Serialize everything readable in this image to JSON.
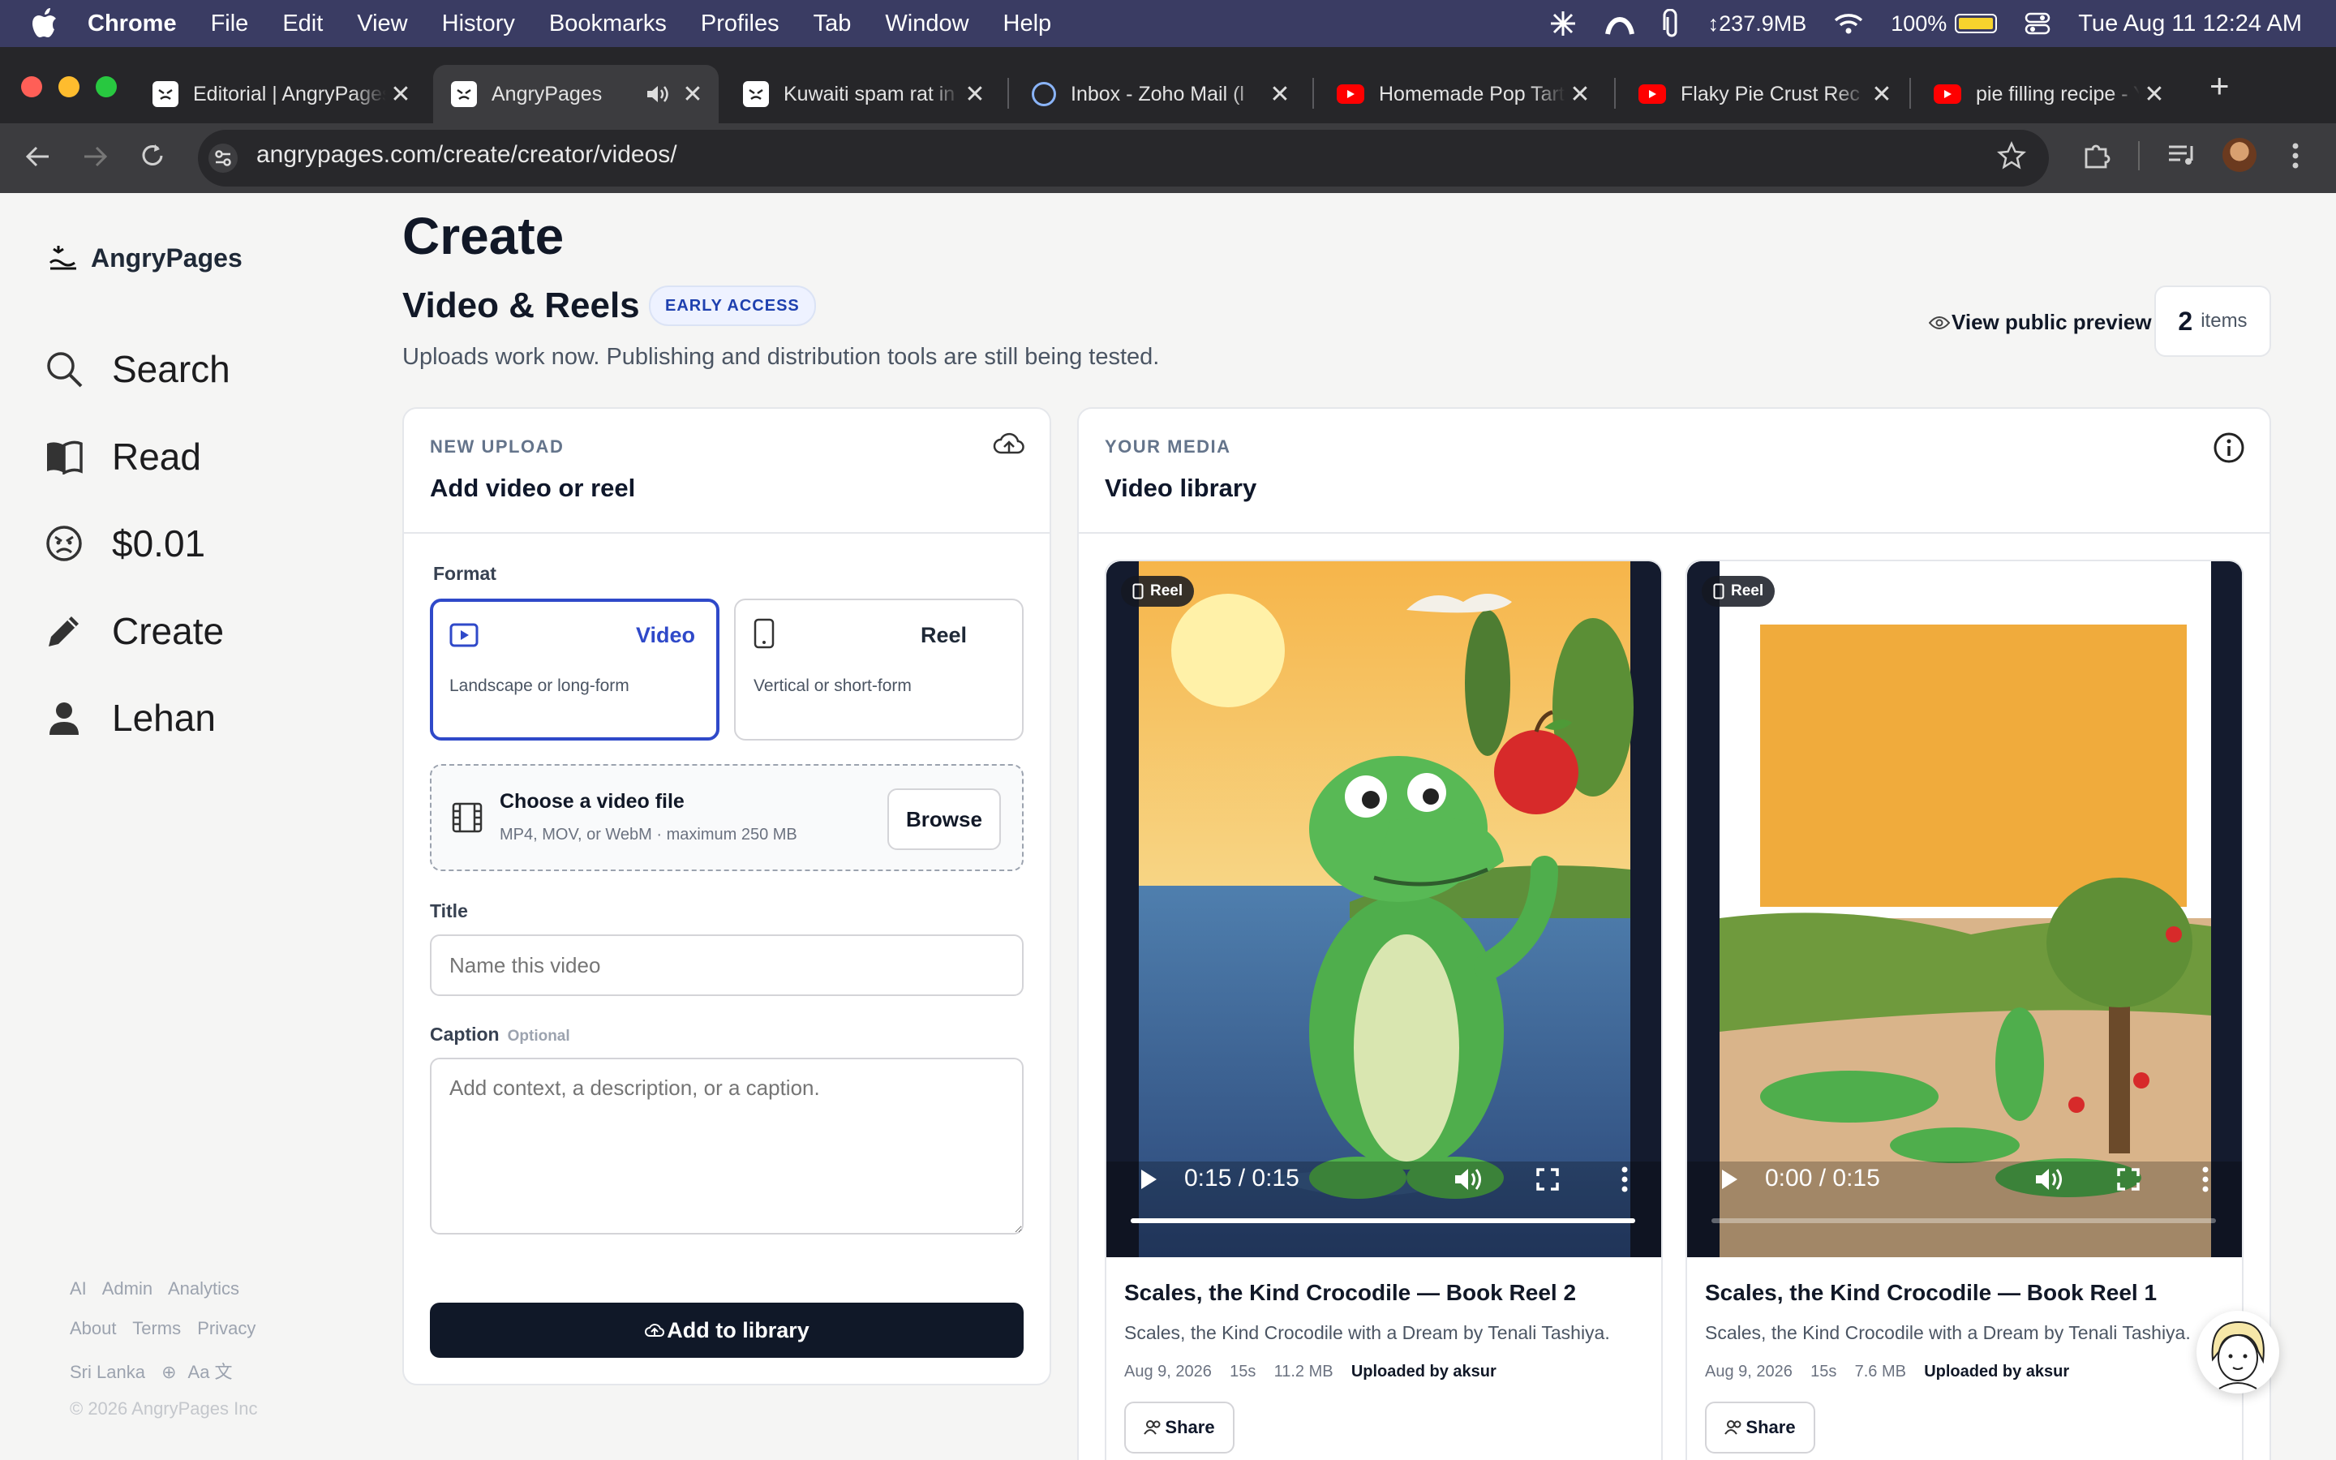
{
  "menubar": {
    "app": "Chrome",
    "items": [
      "File",
      "Edit",
      "View",
      "History",
      "Bookmarks",
      "Profiles",
      "Tab",
      "Window",
      "Help"
    ],
    "memory": "↕237.9MB",
    "battery": "100%",
    "clock": "Tue Aug 11  12:24 AM"
  },
  "tabs": [
    {
      "title": "Editorial | AngryPages",
      "favicon": "angrypages-icon"
    },
    {
      "title": "AngryPages",
      "favicon": "angrypages-icon",
      "active": true
    },
    {
      "title": "Kuwaiti spam rat in",
      "favicon": "angrypages-icon"
    },
    {
      "title": "Inbox - Zoho Mail (l",
      "favicon": "zoho-mail-icon"
    },
    {
      "title": "Homemade Pop Tart",
      "favicon": "youtube-icon"
    },
    {
      "title": "Flaky Pie Crust Rec",
      "favicon": "youtube-icon"
    },
    {
      "title": "pie filling recipe - Y",
      "favicon": "youtube-icon"
    }
  ],
  "address": {
    "url": "angrypages.com/create/creator/videos/"
  },
  "sidebar": {
    "brand": "AngryPages",
    "items": [
      {
        "label": "Search",
        "icon": "search-icon"
      },
      {
        "label": "Read",
        "icon": "book-icon"
      },
      {
        "label": "$0.01",
        "icon": "angry-face-icon"
      },
      {
        "label": "Create",
        "icon": "pencil-icon"
      },
      {
        "label": "Lehan",
        "icon": "person-icon"
      }
    ],
    "footer": {
      "row1": [
        "AI",
        "Admin",
        "Analytics"
      ],
      "row2": [
        "About",
        "Terms",
        "Privacy"
      ],
      "region": "Sri Lanka",
      "lang": "Aa 文",
      "copyright": "© 2026 AngryPages Inc"
    }
  },
  "main": {
    "title": "Create",
    "section_title": "Video & Reels",
    "badge": "EARLY ACCESS",
    "subtitle": "Uploads work now. Publishing and distribution tools are still being tested.",
    "preview_link": "View public preview",
    "item_count": "2",
    "item_count_label": "items"
  },
  "upload": {
    "overline": "NEW UPLOAD",
    "title": "Add video or reel",
    "format_label": "Format",
    "formats": [
      {
        "name": "Video",
        "desc": "Landscape or long-form",
        "icon": "play-screen-icon",
        "selected": true
      },
      {
        "name": "Reel",
        "desc": "Vertical or short-form",
        "icon": "phone-icon",
        "selected": false
      }
    ],
    "file": {
      "title": "Choose a video file",
      "hint": "MP4, MOV, or WebM · maximum 250 MB",
      "browse": "Browse"
    },
    "title_label": "Title",
    "title_placeholder": "Name this video",
    "caption_label": "Caption",
    "caption_optional": "Optional",
    "caption_placeholder": "Add context, a description, or a caption.",
    "submit": "Add to library"
  },
  "library": {
    "overline": "YOUR MEDIA",
    "title": "Video library",
    "items": [
      {
        "badge": "Reel",
        "time": "0:15 / 0:15",
        "progress": 1.0,
        "title": "Scales, the Kind Crocodile — Book Reel 2",
        "desc": "Scales, the Kind Crocodile with a Dream by Tenali Tashiya.",
        "date": "Aug 9, 2026",
        "duration": "15s",
        "size": "11.2 MB",
        "uploader": "Uploaded by aksur",
        "share": "Share"
      },
      {
        "badge": "Reel",
        "time": "0:00 / 0:15",
        "progress": 0.0,
        "title": "Scales, the Kind Crocodile — Book Reel 1",
        "desc": "Scales, the Kind Crocodile with a Dream by Tenali Tashiya.",
        "date": "Aug 9, 2026",
        "duration": "15s",
        "size": "7.6 MB",
        "uploader": "Uploaded by aksur",
        "share": "Share"
      }
    ]
  },
  "colors": {
    "accent": "#2f49c9",
    "primary_button": "#101828",
    "menubar": "#3a3c63",
    "thumb_orange": "#f0ab3c"
  }
}
